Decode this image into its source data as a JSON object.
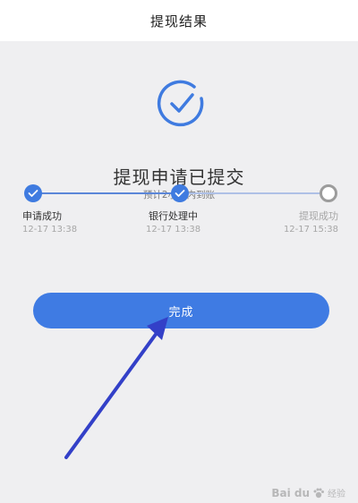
{
  "header": {
    "title": "提现结果"
  },
  "result": {
    "headline": "提现申请已提交",
    "subline": "预计2小时内到账"
  },
  "steps": [
    {
      "label": "申请成功",
      "time": "12-17 13:38",
      "status": "done"
    },
    {
      "label": "银行处理中",
      "time": "12-17 13:38",
      "status": "done"
    },
    {
      "label": "提现成功",
      "time": "12-17 15:38",
      "status": "pending"
    }
  ],
  "actions": {
    "done_label": "完成"
  },
  "watermark": {
    "logo": "Bai du",
    "text": "经验"
  },
  "colors": {
    "accent": "#3f7be3",
    "progress_done": "#5b86d8",
    "pending_gray": "#9c9c9c",
    "annotation_arrow": "#3340c8"
  },
  "icons": {
    "result": "check-circle-icon",
    "step_done": "check-icon",
    "annotation": "arrow-icon"
  }
}
